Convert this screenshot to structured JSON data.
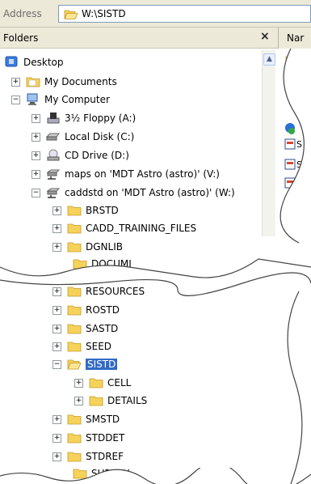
{
  "address": {
    "label": "Address",
    "path": "W:\\SISTD"
  },
  "folders_panel": {
    "title": "Folders",
    "close": "×"
  },
  "right_pane": {
    "header": "Nar"
  },
  "tree": {
    "desktop": "Desktop",
    "my_documents": "My Documents",
    "my_computer": "My Computer",
    "floppy": "3½ Floppy (A:)",
    "local_disk": "Local Disk (C:)",
    "cd_drive": "CD Drive (D:)",
    "maps": "maps on 'MDT Astro (astro)' (V:)",
    "caddstd": "caddstd on 'MDT Astro (astro)' (W:)",
    "brstd": "BRSTD",
    "cadd_training": "CADD_TRAINING_FILES",
    "dgnlib": "DGNLIB",
    "documents_partial": "DOCUMI",
    "resources_partial": "RESOURCES",
    "rostd": "ROSTD",
    "sastd": "SASTD",
    "seed": "SEED",
    "sistd": "SISTD",
    "cell": "CELL",
    "details": "DETAILS",
    "smstd": "SMSTD",
    "stddet": "STDDET",
    "stdref": "STDREF",
    "survey": "SURVEY"
  }
}
